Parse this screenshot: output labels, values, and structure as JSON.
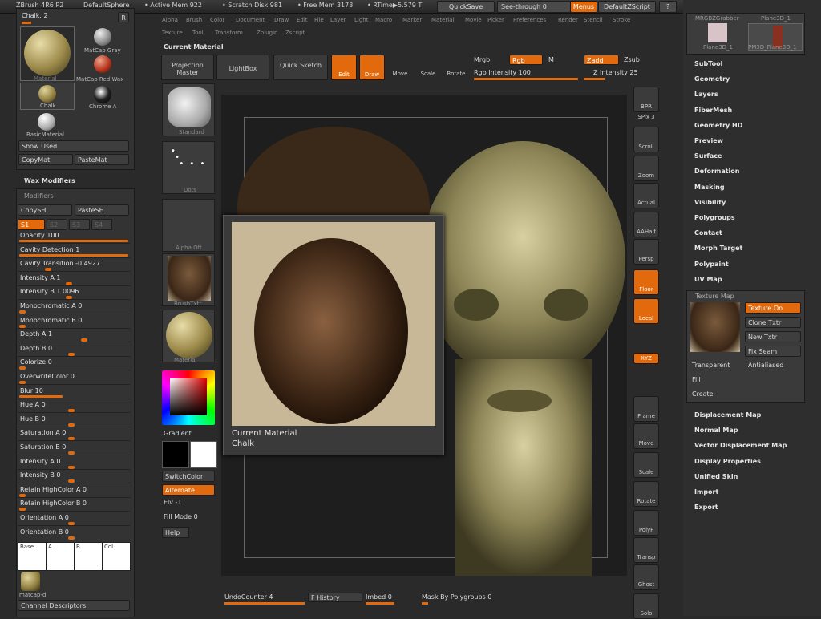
{
  "topbar": {
    "app_info": "ZBrush 4R6 P2",
    "document": "DefaultSphere",
    "active_mem": "• Active Mem 922",
    "scratch_disk": "• Scratch Disk 981",
    "free_mem": "• Free Mem 3173",
    "rtime": "• RTime▶5.579 T",
    "quicksave": "QuickSave",
    "see_through": "See-through  0",
    "menus": "Menus",
    "default_script": "DefaultZScript"
  },
  "menu": [
    "Alpha",
    "Brush",
    "Color",
    "Document",
    "Draw",
    "Edit",
    "File",
    "Layer",
    "Light",
    "Macro",
    "Marker",
    "Material",
    "Movie",
    "Picker",
    "Preferences",
    "Render",
    "Stencil",
    "Stroke",
    "Texture",
    "Tool",
    "Transform",
    "Zplugin",
    "Zscript"
  ],
  "material_panel": {
    "header_value": "Chalk. 2",
    "r_button": "R",
    "current_label": "Material",
    "items": [
      "MatCap Gray",
      "MatCap Red Wax",
      "Chalk",
      "Chrome A",
      "BasicMaterial"
    ],
    "show_used": "Show Used",
    "copy_mat": "CopyMat",
    "paste_mat": "PasteMat",
    "wax_modifiers": "Wax Modifiers",
    "modifiers": "Modifiers",
    "copy_sh": "CopySH",
    "paste_sh": "PasteSH",
    "s1": "S1"
  },
  "sliders": [
    {
      "label": "Opacity",
      "value": "100",
      "level": 1.0
    },
    {
      "label": "Cavity Detection",
      "value": "1",
      "level": 1.0
    },
    {
      "label": "Cavity Transition",
      "value": "-0.4927",
      "level": 0.25
    },
    {
      "label": "Intensity A",
      "value": "1",
      "level": 0.45
    },
    {
      "label": "Intensity B",
      "value": "1.0096",
      "level": 0.45
    },
    {
      "label": "Monochromatic A",
      "value": "0",
      "level": 0.0
    },
    {
      "label": "Monochromatic B",
      "value": "0",
      "level": 0.0
    },
    {
      "label": "Depth A",
      "value": "1",
      "level": 0.6
    },
    {
      "label": "Depth B",
      "value": "0",
      "level": 0.48
    },
    {
      "label": "Colorize",
      "value": "0",
      "level": 0.0
    },
    {
      "label": "OverwriteColor",
      "value": "0",
      "level": 0.0
    },
    {
      "label": "Blur",
      "value": "10",
      "level": 0.4
    },
    {
      "label": "Hue A",
      "value": "0",
      "level": 0.48
    },
    {
      "label": "Hue B",
      "value": "0",
      "level": 0.48
    },
    {
      "label": "Saturation A",
      "value": "0",
      "level": 0.48
    },
    {
      "label": "Saturation B",
      "value": "0",
      "level": 0.48
    },
    {
      "label": "Intensity A",
      "value": "0",
      "level": 0.48
    },
    {
      "label": "Intensity B",
      "value": "0",
      "level": 0.48
    },
    {
      "label": "Retain HighColor A",
      "value": "0",
      "level": 0.0
    },
    {
      "label": "Retain HighColor B",
      "value": "0",
      "level": 0.0
    },
    {
      "label": "Orientation A",
      "value": "0",
      "level": 0.48
    },
    {
      "label": "Orientation B",
      "value": "0",
      "level": 0.48
    }
  ],
  "swatches": [
    "Base",
    "A",
    "B",
    "Col"
  ],
  "matcap_label": "matcap-d",
  "channel_descriptors": "Channel Descriptors",
  "toolbar": {
    "current_material": "Current Material",
    "projection_master": "Projection Master",
    "lightbox": "LightBox",
    "quick_sketch": "Quick Sketch",
    "edit": "Edit",
    "draw": "Draw",
    "move": "Move",
    "scale": "Scale",
    "rotate": "Rotate",
    "mrgb": "Mrgb",
    "rgb": "Rgb",
    "m": "M",
    "rgb_intensity": "Rgb Intensity 100",
    "zadd": "Zadd",
    "zsub": "Zsub",
    "z_intensity": "Z Intensity 25"
  },
  "brush_column": {
    "standard": "Standard",
    "dots": "Dots",
    "alpha_off": "Alpha Off",
    "brush_txtr": "BrushTxtr",
    "material": "Material",
    "gradient": "Gradient",
    "switch_color": "SwitchColor",
    "alternate": "Alternate",
    "elv": "Elv -1",
    "fill_mode": "Fill Mode 0",
    "help": "Help"
  },
  "popup": {
    "title": "Current Material",
    "name": "Chalk"
  },
  "right_tools": [
    "BPR",
    "SPix 3",
    "Scroll",
    "Zoom",
    "Actual",
    "AAHalf",
    "Persp",
    "Floor",
    "Local",
    "XYZ",
    "Frame",
    "Move",
    "Scale",
    "Rotate",
    "PolyF",
    "Transp",
    "Ghost",
    "Solo"
  ],
  "right_menu": {
    "thumbs": [
      "MRGBZGrabber",
      "Plane3D_1",
      "Plane3D_1",
      "PM3D_Plane3D_1"
    ],
    "items_top": [
      "SubTool",
      "Geometry",
      "Layers",
      "FiberMesh",
      "Geometry HD",
      "Preview",
      "Surface",
      "Deformation",
      "Masking",
      "Visibility",
      "Polygroups",
      "Contact",
      "Morph Target",
      "Polypaint",
      "UV Map"
    ],
    "texture_map": "Texture Map",
    "texture_on": "Texture On",
    "clone_txtr": "Clone Txtr",
    "new_txtr": "New Txtr",
    "fix_seam": "Fix Seam",
    "transparent": "Transparent",
    "antialiased": "Antialiased",
    "fill": "Fill",
    "create": "Create",
    "items_bottom": [
      "Displacement Map",
      "Normal Map",
      "Vector Displacement Map",
      "Display Properties",
      "Unified Skin",
      "Import",
      "Export"
    ]
  },
  "bottombar": {
    "undo": "UndoCounter 4",
    "history": "F History",
    "imbed": "Imbed 0",
    "mask": "Mask By Polygroups 0"
  },
  "colors": {
    "accent": "#e26a0c",
    "panel": "#333333",
    "bg": "#2a2a2a"
  }
}
